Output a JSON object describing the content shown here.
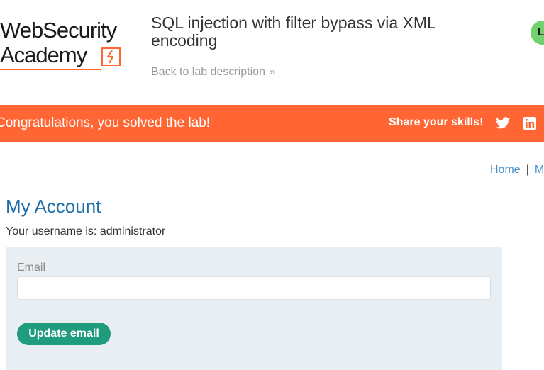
{
  "header": {
    "logo": {
      "line1": "WebSecurity",
      "line2": "Academy"
    },
    "lab_title": "SQL injection with filter bypass via XML encoding",
    "back_link": "Back to lab description",
    "back_chevron": "»",
    "status_initial": "L",
    "status_color": "#70d16d"
  },
  "banner": {
    "message": "Congratulations, you solved the lab!",
    "share_label": "Share your skills!",
    "icons": [
      "twitter-icon",
      "linkedin-icon"
    ],
    "color": "#ff6633"
  },
  "nav": {
    "home": "Home",
    "separator": "|",
    "my_account_partial": "M"
  },
  "main": {
    "title": "My Account",
    "username_text": "Your username is: administrator",
    "form": {
      "email_label": "Email",
      "email_value": "",
      "email_placeholder": "",
      "submit_label": "Update email"
    }
  },
  "colors": {
    "accent": "#ff6633",
    "title_blue": "#1f6fa6",
    "link_blue": "#4a90c8",
    "button_green": "#1f9b7e",
    "panel_bg": "#e9eef2"
  }
}
